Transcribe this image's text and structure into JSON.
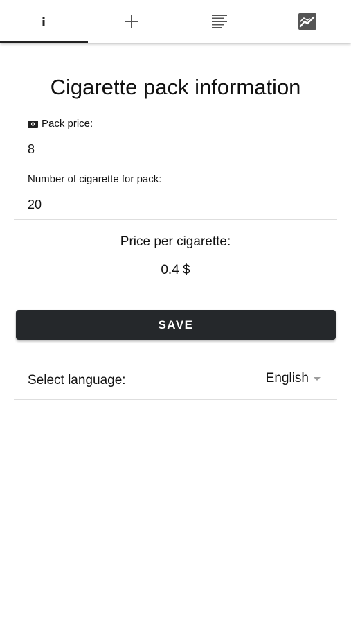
{
  "tabs": [
    {
      "icon": "info-icon",
      "active": true
    },
    {
      "icon": "plus-icon",
      "active": false
    },
    {
      "icon": "list-icon",
      "active": false
    },
    {
      "icon": "chart-icon",
      "active": false
    }
  ],
  "title": "Cigarette pack information",
  "pack_price": {
    "icon": "money-icon",
    "label": "Pack price:",
    "value": "8"
  },
  "pack_count": {
    "label": "Number of cigarette for pack:",
    "value": "20"
  },
  "price_per_cigarette": {
    "label": "Price per cigarette:",
    "value": "0.4 $"
  },
  "save_label": "SAVE",
  "language": {
    "label": "Select language:",
    "selected": "English"
  },
  "colors": {
    "button_bg": "#25282b",
    "button_text": "#ffffff",
    "divider": "#dedede",
    "text": "#111111"
  }
}
